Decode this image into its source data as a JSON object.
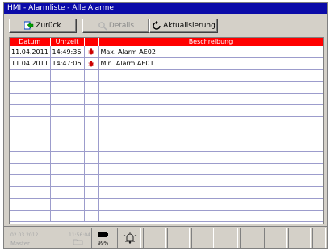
{
  "window": {
    "title": "HMI - Alarmliste - Alle Alarme"
  },
  "toolbar": {
    "back_label": "Zurück",
    "details_label": "Details",
    "refresh_label": "Aktualisierung"
  },
  "table": {
    "columns": [
      "Datum",
      "Uhrzeit",
      "",
      "Beschreibung"
    ],
    "rows": [
      {
        "date": "11.04.2011",
        "time": "14:49:36",
        "icon": "alarm-bug-icon",
        "desc": "Max. Alarm AE02"
      },
      {
        "date": "11.04.2011",
        "time": "14:47:06",
        "icon": "alarm-bug-icon",
        "desc": "Min. Alarm AE01"
      },
      {
        "date": "",
        "time": "",
        "icon": "",
        "desc": ""
      },
      {
        "date": "",
        "time": "",
        "icon": "",
        "desc": ""
      },
      {
        "date": "",
        "time": "",
        "icon": "",
        "desc": ""
      },
      {
        "date": "",
        "time": "",
        "icon": "",
        "desc": ""
      },
      {
        "date": "",
        "time": "",
        "icon": "",
        "desc": ""
      },
      {
        "date": "",
        "time": "",
        "icon": "",
        "desc": ""
      },
      {
        "date": "",
        "time": "",
        "icon": "",
        "desc": ""
      },
      {
        "date": "",
        "time": "",
        "icon": "",
        "desc": ""
      },
      {
        "date": "",
        "time": "",
        "icon": "",
        "desc": ""
      },
      {
        "date": "",
        "time": "",
        "icon": "",
        "desc": ""
      },
      {
        "date": "",
        "time": "",
        "icon": "",
        "desc": ""
      },
      {
        "date": "",
        "time": "",
        "icon": "",
        "desc": ""
      },
      {
        "date": "",
        "time": "",
        "icon": "",
        "desc": ""
      }
    ]
  },
  "status": {
    "date": "02.03.2012",
    "time": "11:56:04",
    "user": "Master",
    "battery": "99%"
  },
  "colors": {
    "title_bg": "#0a0aa8",
    "header_bg": "#ff0000",
    "alarm_icon": "#cc0000"
  }
}
